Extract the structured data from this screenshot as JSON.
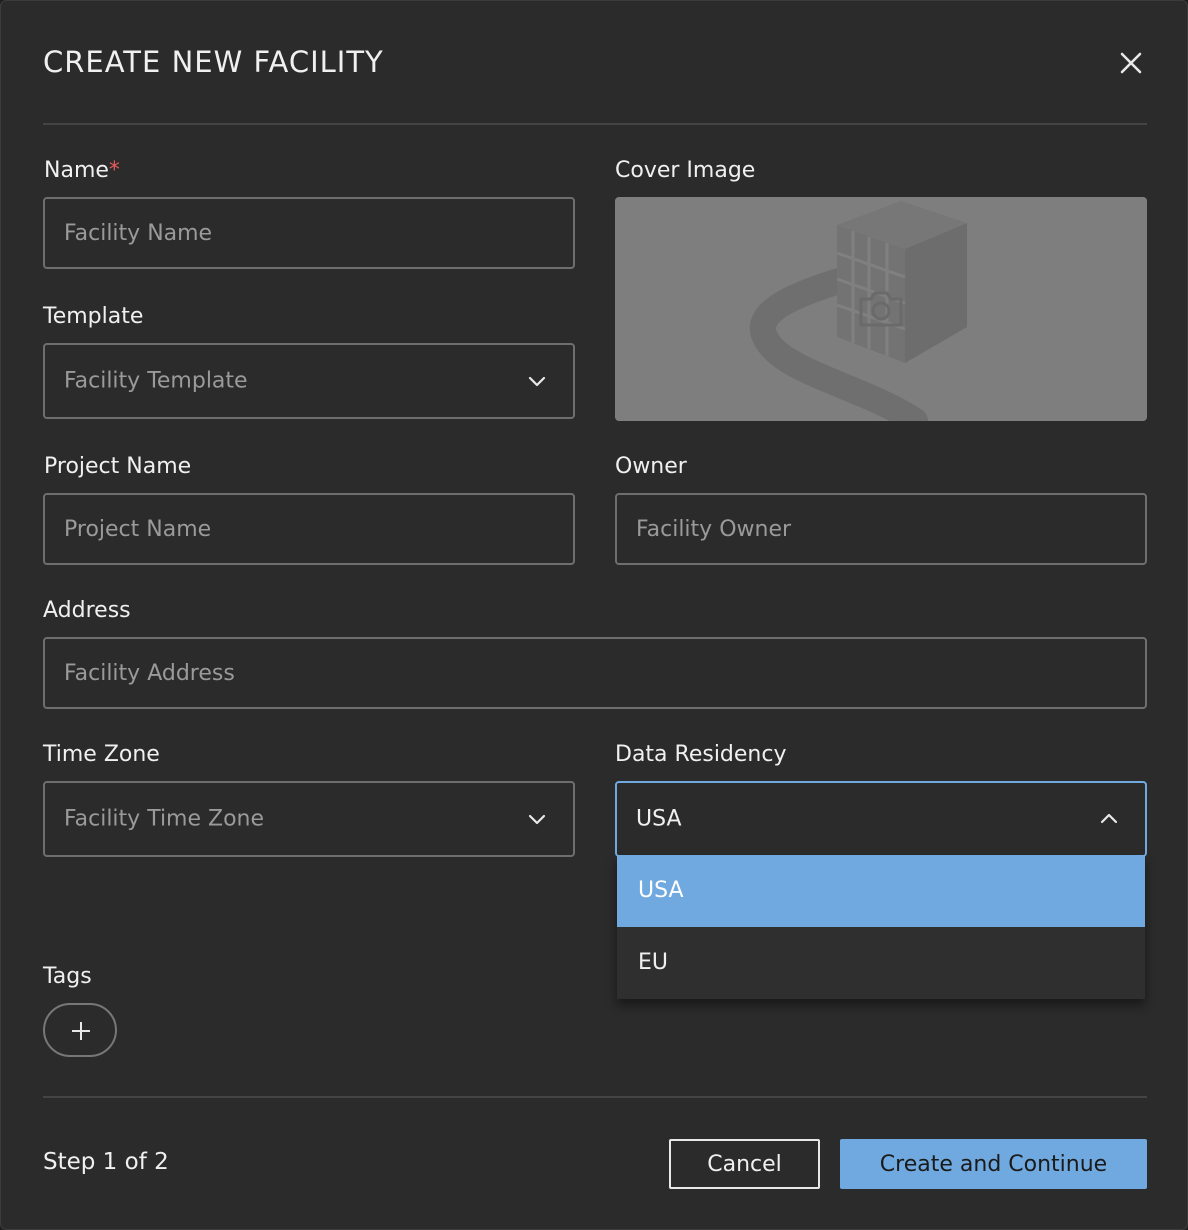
{
  "dialog": {
    "title": "CREATE NEW FACILITY"
  },
  "fields": {
    "name": {
      "label": "Name",
      "required_mark": "*",
      "placeholder": "Facility Name"
    },
    "cover_image": {
      "label": "Cover Image"
    },
    "template": {
      "label": "Template",
      "placeholder": "Facility Template"
    },
    "project_name": {
      "label": "Project Name",
      "placeholder": "Project Name"
    },
    "owner": {
      "label": "Owner",
      "placeholder": "Facility Owner"
    },
    "address": {
      "label": "Address",
      "placeholder": "Facility Address"
    },
    "time_zone": {
      "label": "Time Zone",
      "placeholder": "Facility Time Zone"
    },
    "data_residency": {
      "label": "Data Residency",
      "value": "USA",
      "options": [
        "USA",
        "EU"
      ],
      "selected_option": "USA"
    },
    "tags": {
      "label": "Tags"
    }
  },
  "footer": {
    "step_text": "Step 1 of 2",
    "cancel_label": "Cancel",
    "primary_label": "Create and Continue"
  },
  "colors": {
    "background": "#2b2b2b",
    "accent": "#6fa9df",
    "required": "#e35b5b",
    "input_border": "#6e6e6e"
  },
  "icons": {
    "close": "close-icon",
    "chevron_down": "chevron-down-icon",
    "chevron_up": "chevron-up-icon",
    "camera": "camera-icon",
    "building": "building-illustration",
    "add": "plus-icon"
  }
}
